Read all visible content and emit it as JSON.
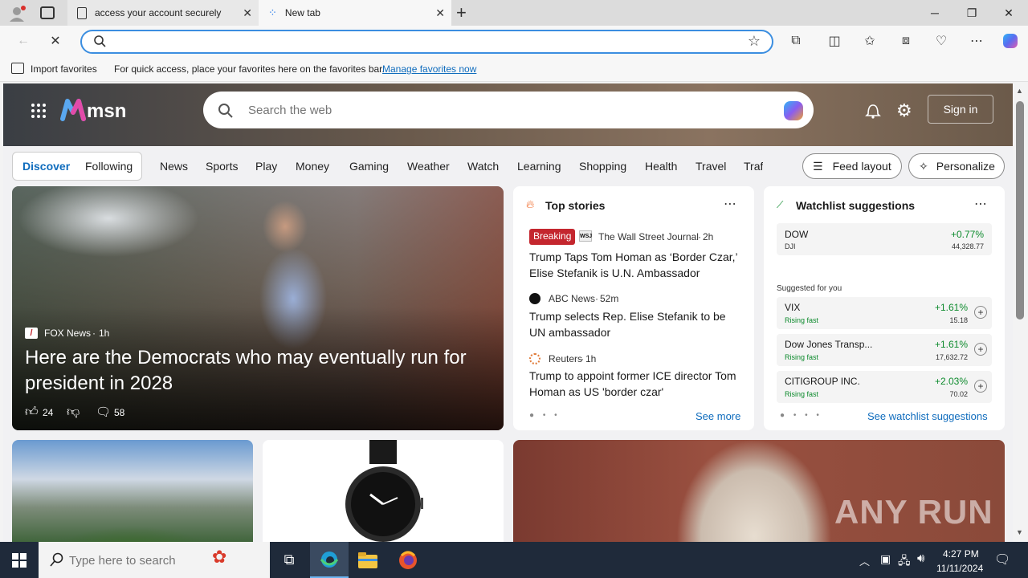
{
  "browser": {
    "tabs": [
      {
        "title": "access your account securely"
      },
      {
        "title": "New tab"
      }
    ],
    "new_tab_glyph": "+",
    "address": {
      "value": "",
      "placeholder": ""
    },
    "favorites_bar": {
      "import_label": "Import favorites",
      "hint": "For quick access, place your favorites here on the favorites bar.",
      "manage_link": "Manage favorites now"
    }
  },
  "msn": {
    "logo_text": "msn",
    "search_placeholder": "Search the web",
    "sign_in": "Sign in",
    "tabs": [
      "Discover",
      "Following"
    ],
    "nav": [
      "News",
      "Sports",
      "Play",
      "Money",
      "Gaming",
      "Weather",
      "Watch",
      "Learning",
      "Shopping",
      "Health",
      "Travel",
      "Traf"
    ],
    "feed_layout": "Feed layout",
    "personalize": "Personalize",
    "hero_story": {
      "source": "FOX News",
      "age": "1h",
      "title": "Here are the Democrats who may eventually run for president in 2028",
      "likes": "24",
      "comments": "58"
    },
    "top_stories": {
      "heading": "Top stories",
      "items": [
        {
          "badge": "Breaking",
          "source": "The Wall Street Journal",
          "age": "2h",
          "title": "Trump Taps Tom Homan as ‘Border Czar,’ Elise Stefanik is U.N. Ambassador"
        },
        {
          "source": "ABC News",
          "age": "52m",
          "title": "Trump selects Rep. Elise Stefanik to be UN ambassador"
        },
        {
          "source": "Reuters",
          "age": "1h",
          "title": "Trump to appoint former ICE director Tom Homan as US 'border czar'"
        }
      ],
      "see_more": "See more"
    },
    "watchlist": {
      "heading": "Watchlist suggestions",
      "main": {
        "symbol": "DOW",
        "sub": "DJI",
        "change": "+0.77%",
        "price": "44,328.77"
      },
      "suggested_label": "Suggested for you",
      "items": [
        {
          "name": "VIX",
          "status": "Rising fast",
          "change": "+1.61%",
          "price": "15.18"
        },
        {
          "name": "Dow Jones Transp...",
          "status": "Rising fast",
          "change": "+1.61%",
          "price": "17,632.72"
        },
        {
          "name": "CITIGROUP INC.",
          "status": "Rising fast",
          "change": "+2.03%",
          "price": "70.02"
        }
      ],
      "see_more": "See watchlist suggestions"
    },
    "watermark": "ANY RUN"
  },
  "taskbar": {
    "search_placeholder": "Type here to search",
    "time": "4:27 PM",
    "date": "11/11/2024"
  },
  "colors": {
    "accent": "#0f6cbd",
    "breaking": "#c4262e",
    "positive": "#0c8a2c"
  }
}
